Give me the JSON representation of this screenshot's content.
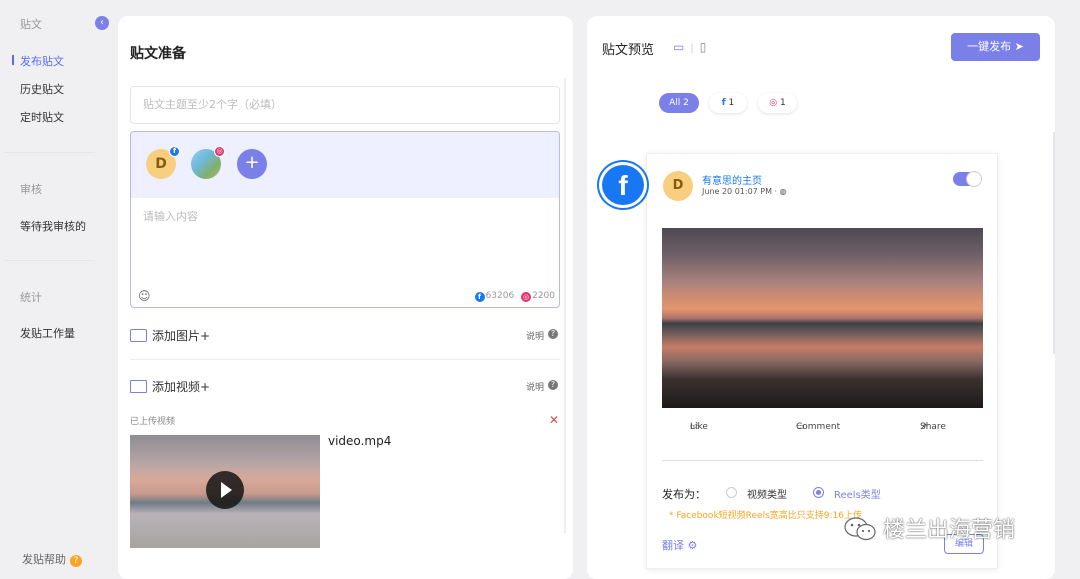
{
  "nav": {
    "section_posts": "贴文",
    "item_publish": "发布贴文",
    "item_history": "历史贴文",
    "item_scheduled": "定时贴文",
    "section_review": "审核",
    "item_pending_review": "等待我审核的",
    "section_stats": "统计",
    "item_workload": "发贴工作量",
    "help": "发贴帮助",
    "collapse_icon": "chevron-left-icon"
  },
  "editor": {
    "title": "贴文准备",
    "subject_placeholder": "贴文主题至少2个字（必填）",
    "account_avatar_letter": "D",
    "content_placeholder": "请输入内容",
    "fb_count": "63206",
    "ig_count": "2200",
    "add_image": "添加图片+",
    "add_video": "添加视频+",
    "explain": "说明",
    "uploaded_label": "已上传视频",
    "video_filename": "video.mp4"
  },
  "preview": {
    "title": "贴文预览",
    "publish_button": "一键发布",
    "filters": {
      "all": "All 2",
      "fb": "1",
      "ig": "1"
    },
    "page_name": "有意思的主页",
    "avatar_letter": "D",
    "post_time": "June 20 01:07 PM · ",
    "like": "Like",
    "comment": "Comment",
    "share": "Share",
    "publish_as": "发布为：",
    "type_video": "视频类型",
    "type_reels": "Reels类型",
    "selected_type": "Reels类型",
    "warning": "* Facebook短视频Reels宽高比只支持9:16上传",
    "translate": "翻译",
    "edit": "编辑"
  },
  "watermark": "楼兰出海营销",
  "colors": {
    "accent": "#7b7fe8",
    "facebook": "#1877f2",
    "instagram": "#e1306c",
    "warning": "#f5a623",
    "remove": "#e54545"
  }
}
